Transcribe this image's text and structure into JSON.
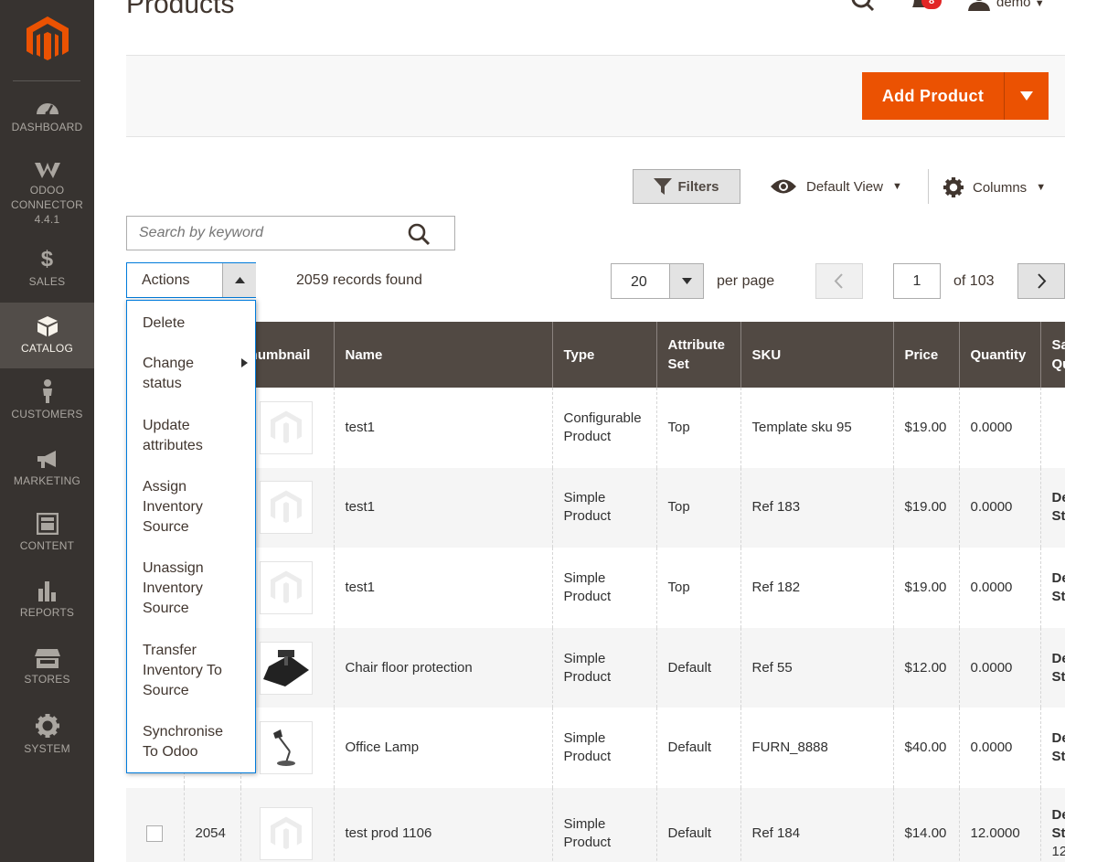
{
  "sidebar": {
    "logo": "magento-logo",
    "items": [
      {
        "label": "DASHBOARD",
        "icon": "dashboard-icon"
      },
      {
        "label": "ODOO CONNECTOR 4.4.1",
        "line1": "ODOO",
        "line2": "CONNECTOR",
        "line3": "4.4.1",
        "icon": "odoo-icon"
      },
      {
        "label": "SALES",
        "icon": "dollar-icon"
      },
      {
        "label": "CATALOG",
        "icon": "catalog-box-icon",
        "active": true
      },
      {
        "label": "CUSTOMERS",
        "icon": "person-icon"
      },
      {
        "label": "MARKETING",
        "icon": "megaphone-icon"
      },
      {
        "label": "CONTENT",
        "icon": "content-layout-icon"
      },
      {
        "label": "REPORTS",
        "icon": "bar-chart-icon"
      },
      {
        "label": "STORES",
        "icon": "store-icon"
      },
      {
        "label": "SYSTEM",
        "icon": "gear-icon"
      }
    ]
  },
  "header": {
    "title": "Products",
    "notifications_count": "8",
    "username": "demo"
  },
  "action_bar": {
    "add_product_label": "Add Product"
  },
  "toolbar": {
    "filters_label": "Filters",
    "view_label": "Default View",
    "columns_label": "Columns",
    "search_placeholder": "Search by keyword",
    "actions_label": "Actions",
    "records_found": "2059 records found",
    "per_page_value": "20",
    "per_page_label": "per page",
    "current_page": "1",
    "total_pages_label": "of 103"
  },
  "actions_menu": [
    "Delete",
    "Change status",
    "Update attributes",
    "Assign Inventory Source",
    "Unassign Inventory Source",
    "Transfer Inventory To Source",
    "Synchronise To Odoo"
  ],
  "actions_menu_lines": [
    [
      "Delete"
    ],
    [
      "Change",
      "status"
    ],
    [
      "Update",
      "attributes"
    ],
    [
      "Assign",
      "Inventory",
      "Source"
    ],
    [
      "Unassign",
      "Inventory",
      "Source"
    ],
    [
      "Transfer",
      "Inventory To",
      "Source"
    ],
    [
      "Synchronise",
      "To Odoo"
    ]
  ],
  "grid": {
    "columns": [
      "Thumbnail",
      "Name",
      "Type",
      "Attribute Set",
      "SKU",
      "Price",
      "Quantity",
      "Sa Qu"
    ],
    "rows": [
      {
        "id": "",
        "thumb": "placeholder",
        "name": "test1",
        "type1": "Configurable",
        "type2": "Product",
        "attribute_set": "Top",
        "sku": "Template sku 95",
        "price": "$19.00",
        "quantity": "0.0000",
        "salable1": "",
        "salable2": ""
      },
      {
        "id": "",
        "thumb": "placeholder",
        "name": "test1",
        "type1": "Simple",
        "type2": "Product",
        "attribute_set": "Top",
        "sku": "Ref 183",
        "price": "$19.00",
        "quantity": "0.0000",
        "salable1": "De",
        "salable2": "St"
      },
      {
        "id": "",
        "thumb": "placeholder",
        "name": "test1",
        "type1": "Simple",
        "type2": "Product",
        "attribute_set": "Top",
        "sku": "Ref 182",
        "price": "$19.00",
        "quantity": "0.0000",
        "salable1": "De",
        "salable2": "St"
      },
      {
        "id": "",
        "thumb": "chair-mat",
        "name": "Chair floor protection",
        "type1": "Simple",
        "type2": "Product",
        "attribute_set": "Default",
        "sku": "Ref 55",
        "price": "$12.00",
        "quantity": "0.0000",
        "salable1": "De",
        "salable2": "St"
      },
      {
        "id": "",
        "thumb": "lamp",
        "name": "Office Lamp",
        "type1": "Simple",
        "type2": "Product",
        "attribute_set": "Default",
        "sku": "FURN_8888",
        "price": "$40.00",
        "quantity": "0.0000",
        "salable1": "De",
        "salable2": "St"
      },
      {
        "id": "2054",
        "thumb": "placeholder",
        "name": "test prod 1106",
        "type1": "Simple",
        "type2": "Product",
        "attribute_set": "Default",
        "sku": "Ref 184",
        "price": "$14.00",
        "quantity": "12.0000",
        "salable1": "De",
        "salable2": "St",
        "salable3": "12"
      }
    ]
  },
  "colors": {
    "sidebar_bg": "#373330",
    "accent": "#eb5202",
    "grid_header": "#514943",
    "focus_border": "#007bdb"
  }
}
